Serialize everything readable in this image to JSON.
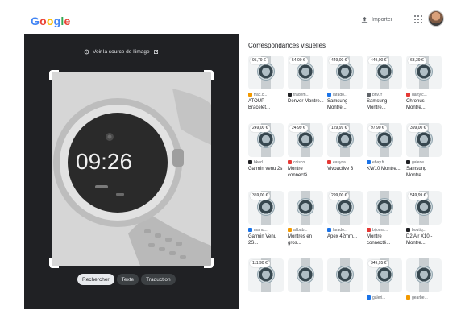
{
  "header": {
    "logo": [
      "G",
      "o",
      "o",
      "g",
      "l",
      "e"
    ],
    "import_label": "Importer"
  },
  "left": {
    "source_label": "Voir la source de l'image",
    "watch_time": "09:26",
    "modes": [
      "Rechercher",
      "Texte",
      "Traduction"
    ],
    "active_mode": "Rechercher"
  },
  "results": {
    "title": "Correspondances visuelles",
    "items": [
      {
        "price": "95,79 €",
        "source": "trac.c...",
        "name": "ATOUP Bracelet...",
        "fav": "#f29900"
      },
      {
        "price": "54,00 €",
        "source": "tradem...",
        "name": "Denver Montre...",
        "fav": "#202124"
      },
      {
        "price": "449,00 €",
        "source": "larado...",
        "name": "Samsung Montre...",
        "fav": "#1a73e8"
      },
      {
        "price": "449,00 €",
        "source": "bhv.fr",
        "name": "Samsung - Montre...",
        "fav": "#5f6368"
      },
      {
        "price": "63,39 €",
        "source": "darty.c...",
        "name": "Chronus Montre...",
        "fav": "#e53935"
      },
      {
        "price": "249,00 €",
        "source": "bked...",
        "name": "Garmin venu 2s",
        "fav": "#202124"
      },
      {
        "price": "24,99 €",
        "source": "cdisco...",
        "name": "Montre connecté...",
        "fav": "#e53935"
      },
      {
        "price": "129,99 €",
        "source": "easyca...",
        "name": "Vivoactive 3",
        "fav": "#e53935"
      },
      {
        "price": "97,90 €",
        "source": "ebay.fr",
        "name": "KW10 Montre...",
        "fav": "#1a73e8"
      },
      {
        "price": "399,00 €",
        "source": "galerie...",
        "name": "Samsung Montre...",
        "fav": "#202124"
      },
      {
        "price": "359,00 €",
        "source": "mano...",
        "name": "Garmin Venu 2S...",
        "fav": "#1a73e8"
      },
      {
        "price": "",
        "source": "alibab...",
        "name": "Montres en gros...",
        "fav": "#f29900"
      },
      {
        "price": "299,00 €",
        "source": "larado...",
        "name": "Apex 42mm...",
        "fav": "#1a73e8"
      },
      {
        "price": "",
        "source": "bijoura...",
        "name": "Montre connecté...",
        "fav": "#e53935"
      },
      {
        "price": "549,99 €",
        "source": "boutiq...",
        "name": "D2 Air X10 - Montre...",
        "fav": "#202124"
      },
      {
        "price": "111,90 €",
        "source": "",
        "name": "",
        "fav": "#5f6368"
      },
      {
        "price": "",
        "source": "",
        "name": "",
        "fav": "#5f6368"
      },
      {
        "price": "",
        "source": "",
        "name": "",
        "fav": "#5f6368"
      },
      {
        "price": "349,95 €",
        "source": "galeri...",
        "name": "",
        "fav": "#1a73e8"
      },
      {
        "price": "",
        "source": "gearbe...",
        "name": "",
        "fav": "#f29900"
      }
    ]
  },
  "colors": {
    "dark_pane": "#202124",
    "accent": "#1a73e8"
  }
}
